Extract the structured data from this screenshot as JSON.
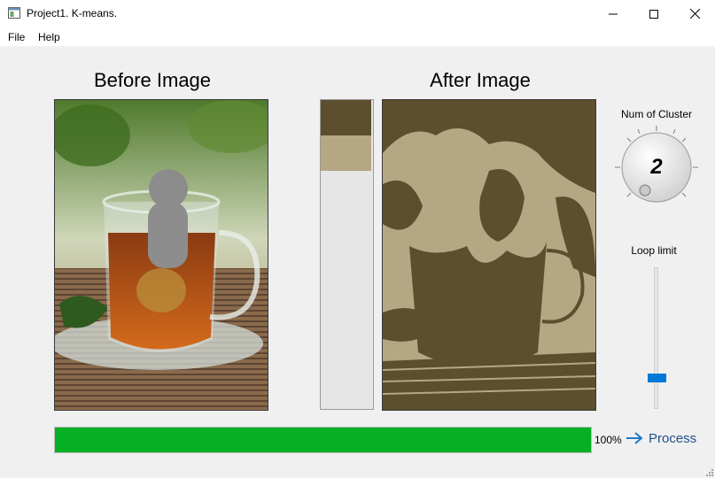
{
  "window": {
    "title": "Project1. K-means."
  },
  "menu": {
    "items": [
      {
        "label": "File"
      },
      {
        "label": "Help"
      }
    ]
  },
  "panels": {
    "before_title": "Before Image",
    "after_title": "After Image"
  },
  "palette": {
    "colors": [
      "#5c4e2e",
      "#b6a784"
    ]
  },
  "cluster": {
    "label": "Num of Cluster",
    "value": "2"
  },
  "loop": {
    "label": "Loop limit",
    "level": 0.2
  },
  "progress": {
    "value": 1.0,
    "text": "100%"
  },
  "process": {
    "label": "Process"
  },
  "colors": {
    "progress": "#06b025",
    "accent": "#0078d7",
    "dark_cluster": "#5c4e2e",
    "light_cluster": "#b6a784"
  }
}
